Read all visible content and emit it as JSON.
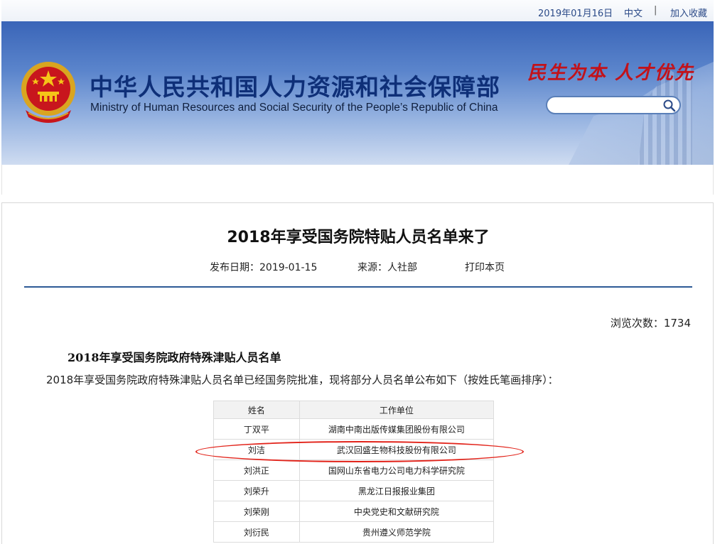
{
  "topbar": {
    "date": "2019年01月16日",
    "lang": "中文",
    "separator": "|",
    "favorite": "加入收藏"
  },
  "header": {
    "title_cn": "中华人民共和国人力资源和社会保障部",
    "title_en": "Ministry of Human Resources and Social Security of the People’s Republic of China",
    "slogan": "民生为本 人才优先",
    "search_placeholder": "",
    "search_icon": "search-icon",
    "emblem_icon": "national-emblem",
    "brand_color": "#0e2f78",
    "slogan_color": "#c2121a"
  },
  "article": {
    "title": "2018年享受国务院特贴人员名单来了",
    "publish_date": "发布日期：2019-01-15",
    "source": "来源：人社部",
    "print": "打印本页",
    "views": "浏览次数：1734",
    "section_heading": "2018年享受国务院政府特殊津贴人员名单",
    "intro": "2018年享受国务院政府特殊津贴人员名单已经国务院批准，现将部分人员名单公布如下（按姓氏笔画排序）："
  },
  "table": {
    "headers": [
      "姓名",
      "工作单位"
    ],
    "rows": [
      {
        "name": "丁双平",
        "unit": "湖南中南出版传媒集团股份有限公司"
      },
      {
        "name": "刘洁",
        "unit": "武汉回盛生物科技股份有限公司"
      },
      {
        "name": "刘洪正",
        "unit": "国网山东省电力公司电力科学研究院"
      },
      {
        "name": "刘荣升",
        "unit": "黑龙江日报报业集团"
      },
      {
        "name": "刘荣刚",
        "unit": "中央党史和文献研究院"
      },
      {
        "name": "刘衍民",
        "unit": "贵州遵义师范学院"
      }
    ],
    "highlight_color": "#e2231a"
  }
}
